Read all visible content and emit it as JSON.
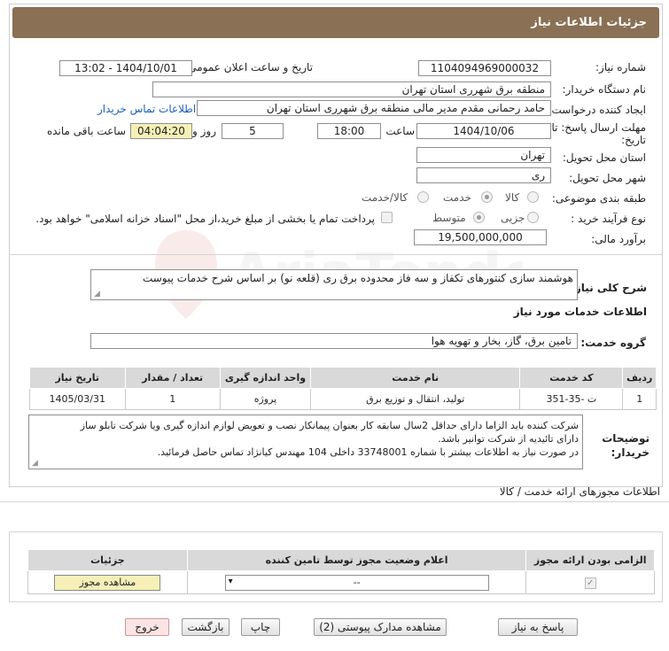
{
  "header": {
    "title": "جزئیات اطلاعات نیاز"
  },
  "form": {
    "need_number_label": "شماره نیاز:",
    "need_number": "1104094969000032",
    "announce_label": "تاریخ و ساعت اعلان عمومی:",
    "announce_value": "1404/10/01 - 13:02",
    "buyer_org_label": "نام دستگاه خریدار:",
    "buyer_org": "منطقه برق شهرری استان تهران",
    "creator_label": "ایجاد کننده درخواست:",
    "creator": "حامد رحمانی مقدم مدیر مالی منطقه برق شهرری استان تهران",
    "contact_link": "اطلاعات تماس خریدار",
    "deadline_label_1": "مهلت ارسال پاسخ: تا",
    "deadline_label_2": "تاریخ:",
    "deadline_date": "1404/10/06",
    "time_label": "ساعت",
    "deadline_time": "18:00",
    "days": "5",
    "days_label": "روز و",
    "remaining": "04:04:20",
    "remaining_label": "ساعت باقی مانده",
    "province_label": "استان محل تحویل:",
    "province": "تهران",
    "city_label": "شهر محل تحویل:",
    "city": "ری",
    "category_label": "طبقه بندی موضوعی:",
    "category_options": [
      "کالا",
      "خدمت",
      "کالا/خدمت"
    ],
    "process_label": "نوع فرآیند خرید :",
    "process_options": [
      "جزیی",
      "متوسط"
    ],
    "payment_note": "پرداخت تمام یا بخشی از مبلغ خرید،از محل \"اسناد خزانه اسلامی\" خواهد بود.",
    "budget_label": "برآورد مالی:",
    "budget": "19,500,000,000"
  },
  "summary": {
    "label": "شرح کلی نیاز:",
    "text": "هوشمند سازی کنتورهای تکفاز و سه فاز محدوده برق ری (قلعه نو) بر اساس شرح خدمات پیوست"
  },
  "services": {
    "section_title": "اطلاعات خدمات مورد نیاز",
    "group_label": "گروه خدمت:",
    "group_value": "تامین برق، گاز، بخار و تهویه هوا",
    "columns": [
      "ردیف",
      "کد خدمت",
      "نام خدمت",
      "واحد اندازه گیری",
      "تعداد / مقدار",
      "تاریخ نیاز"
    ],
    "rows": [
      [
        "1",
        "ت -35-351",
        "تولید، انتقال و توزیع برق",
        "پروژه",
        "1",
        "1405/03/31"
      ]
    ]
  },
  "buyer_notes": {
    "label_1": "توضیحات",
    "label_2": "خریدار:",
    "line_1": "شرکت کننده باید الزاما دارای حداقل 2سال سابقه کار بعنوان پیمانکار نصب و تعویض لوازم اندازه گیری ویا شرکت تابلو ساز",
    "line_2": "دارای تائیدیه از شرکت توانیر باشد.",
    "line_3": "در صورت نیاز به اطلاعات بیشتر با شماره 33748001 داخلی 104 مهندس کیانژاد تماس حاصل فرمائید."
  },
  "permits": {
    "section_title": "اطلاعات مجوزهای ارائه خدمت / کالا",
    "columns": [
      "الزامی بودن ارائه مجوز",
      "اعلام وضعیت مجوز توسط تامین کننده",
      "جزئیات"
    ],
    "select_value": "--",
    "view_button": "مشاهده مجوز"
  },
  "footer_buttons": {
    "reply": "پاسخ به نیاز",
    "docs": "مشاهده مدارک پیوستی (2)",
    "print": "چاپ",
    "back": "بازگشت",
    "exit": "خروج"
  },
  "watermark": {
    "text": "AriaTender.net"
  },
  "colors": {
    "header_bg": "#8a7054",
    "link": "#1f5fbf",
    "remaining_bg": "#f6f0b8"
  }
}
